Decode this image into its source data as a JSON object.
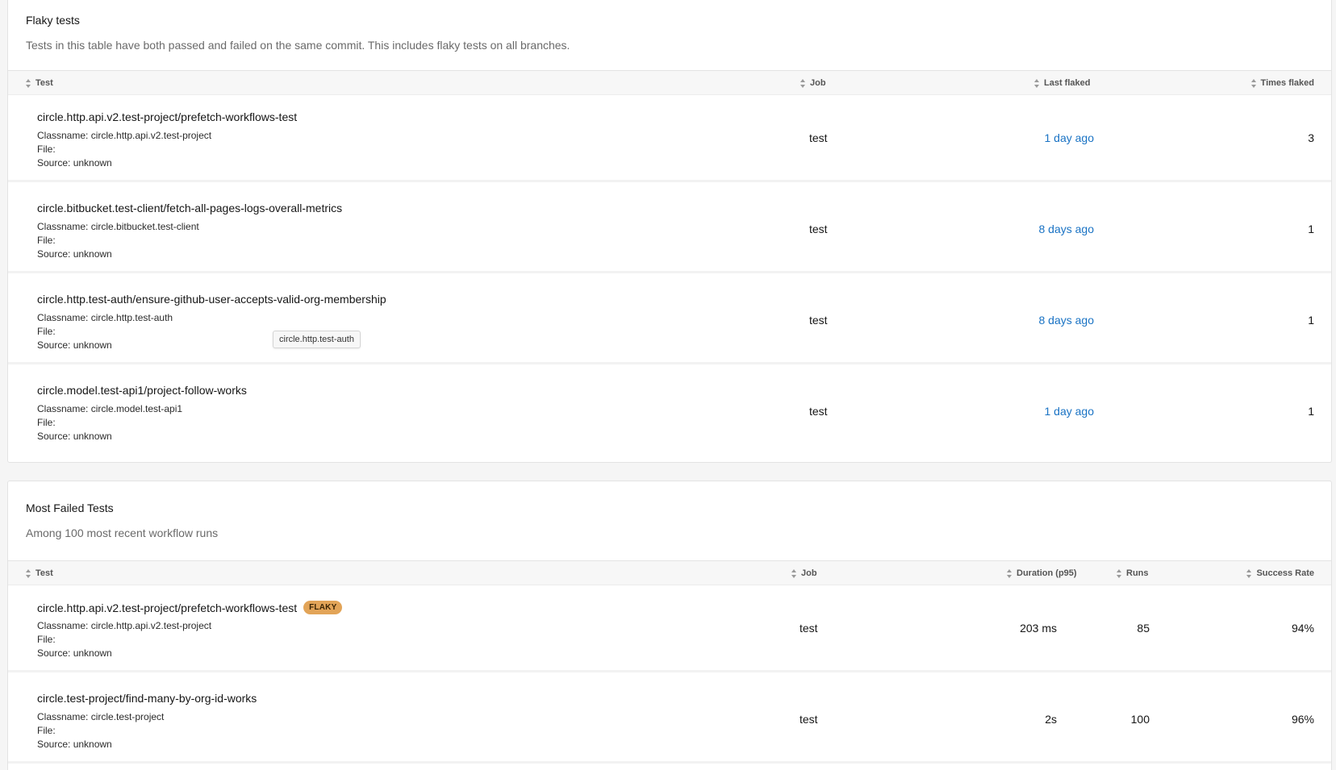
{
  "flaky": {
    "title": "Flaky tests",
    "description": "Tests in this table have both passed and failed on the same commit. This includes flaky tests on all branches.",
    "columns": {
      "test": "Test",
      "job": "Job",
      "last_flaked": "Last flaked",
      "times_flaked": "Times flaked"
    },
    "rows": [
      {
        "name": "circle.http.api.v2.test-project/prefetch-workflows-test",
        "classname": "Classname: circle.http.api.v2.test-project",
        "file": "File:",
        "source": "Source: unknown",
        "job": "test",
        "last_flaked": "1 day ago",
        "times_flaked": "3"
      },
      {
        "name": "circle.bitbucket.test-client/fetch-all-pages-logs-overall-metrics",
        "classname": "Classname: circle.bitbucket.test-client",
        "file": "File:",
        "source": "Source: unknown",
        "job": "test",
        "last_flaked": "8 days ago",
        "times_flaked": "1"
      },
      {
        "name": "circle.http.test-auth/ensure-github-user-accepts-valid-org-membership",
        "classname": "Classname: circle.http.test-auth",
        "file": "File:",
        "source": "Source: unknown",
        "job": "test",
        "last_flaked": "8 days ago",
        "times_flaked": "1"
      },
      {
        "name": "circle.model.test-api1/project-follow-works",
        "classname": "Classname: circle.model.test-api1",
        "file": "File:",
        "source": "Source: unknown",
        "job": "test",
        "last_flaked": "1 day ago",
        "times_flaked": "1"
      }
    ]
  },
  "tooltip": {
    "text": "circle.http.test-auth"
  },
  "failed": {
    "title": "Most Failed Tests",
    "description": "Among 100 most recent workflow runs",
    "columns": {
      "test": "Test",
      "job": "Job",
      "duration": "Duration (p95)",
      "runs": "Runs",
      "success_rate": "Success Rate"
    },
    "rows": [
      {
        "name": "circle.http.api.v2.test-project/prefetch-workflows-test",
        "badge": "FLAKY",
        "classname": "Classname: circle.http.api.v2.test-project",
        "file": "File:",
        "source": "Source: unknown",
        "job": "test",
        "duration": "203 ms",
        "runs": "85",
        "success_rate": "94%"
      },
      {
        "name": "circle.test-project/find-many-by-org-id-works",
        "badge": "",
        "classname": "Classname: circle.test-project",
        "file": "File:",
        "source": "Source: unknown",
        "job": "test",
        "duration": "2s",
        "runs": "100",
        "success_rate": "96%"
      }
    ]
  },
  "colors": {
    "link": "#1a73c4",
    "flaky_badge": "#e2a458",
    "muted_text": "#6a6a6a"
  }
}
